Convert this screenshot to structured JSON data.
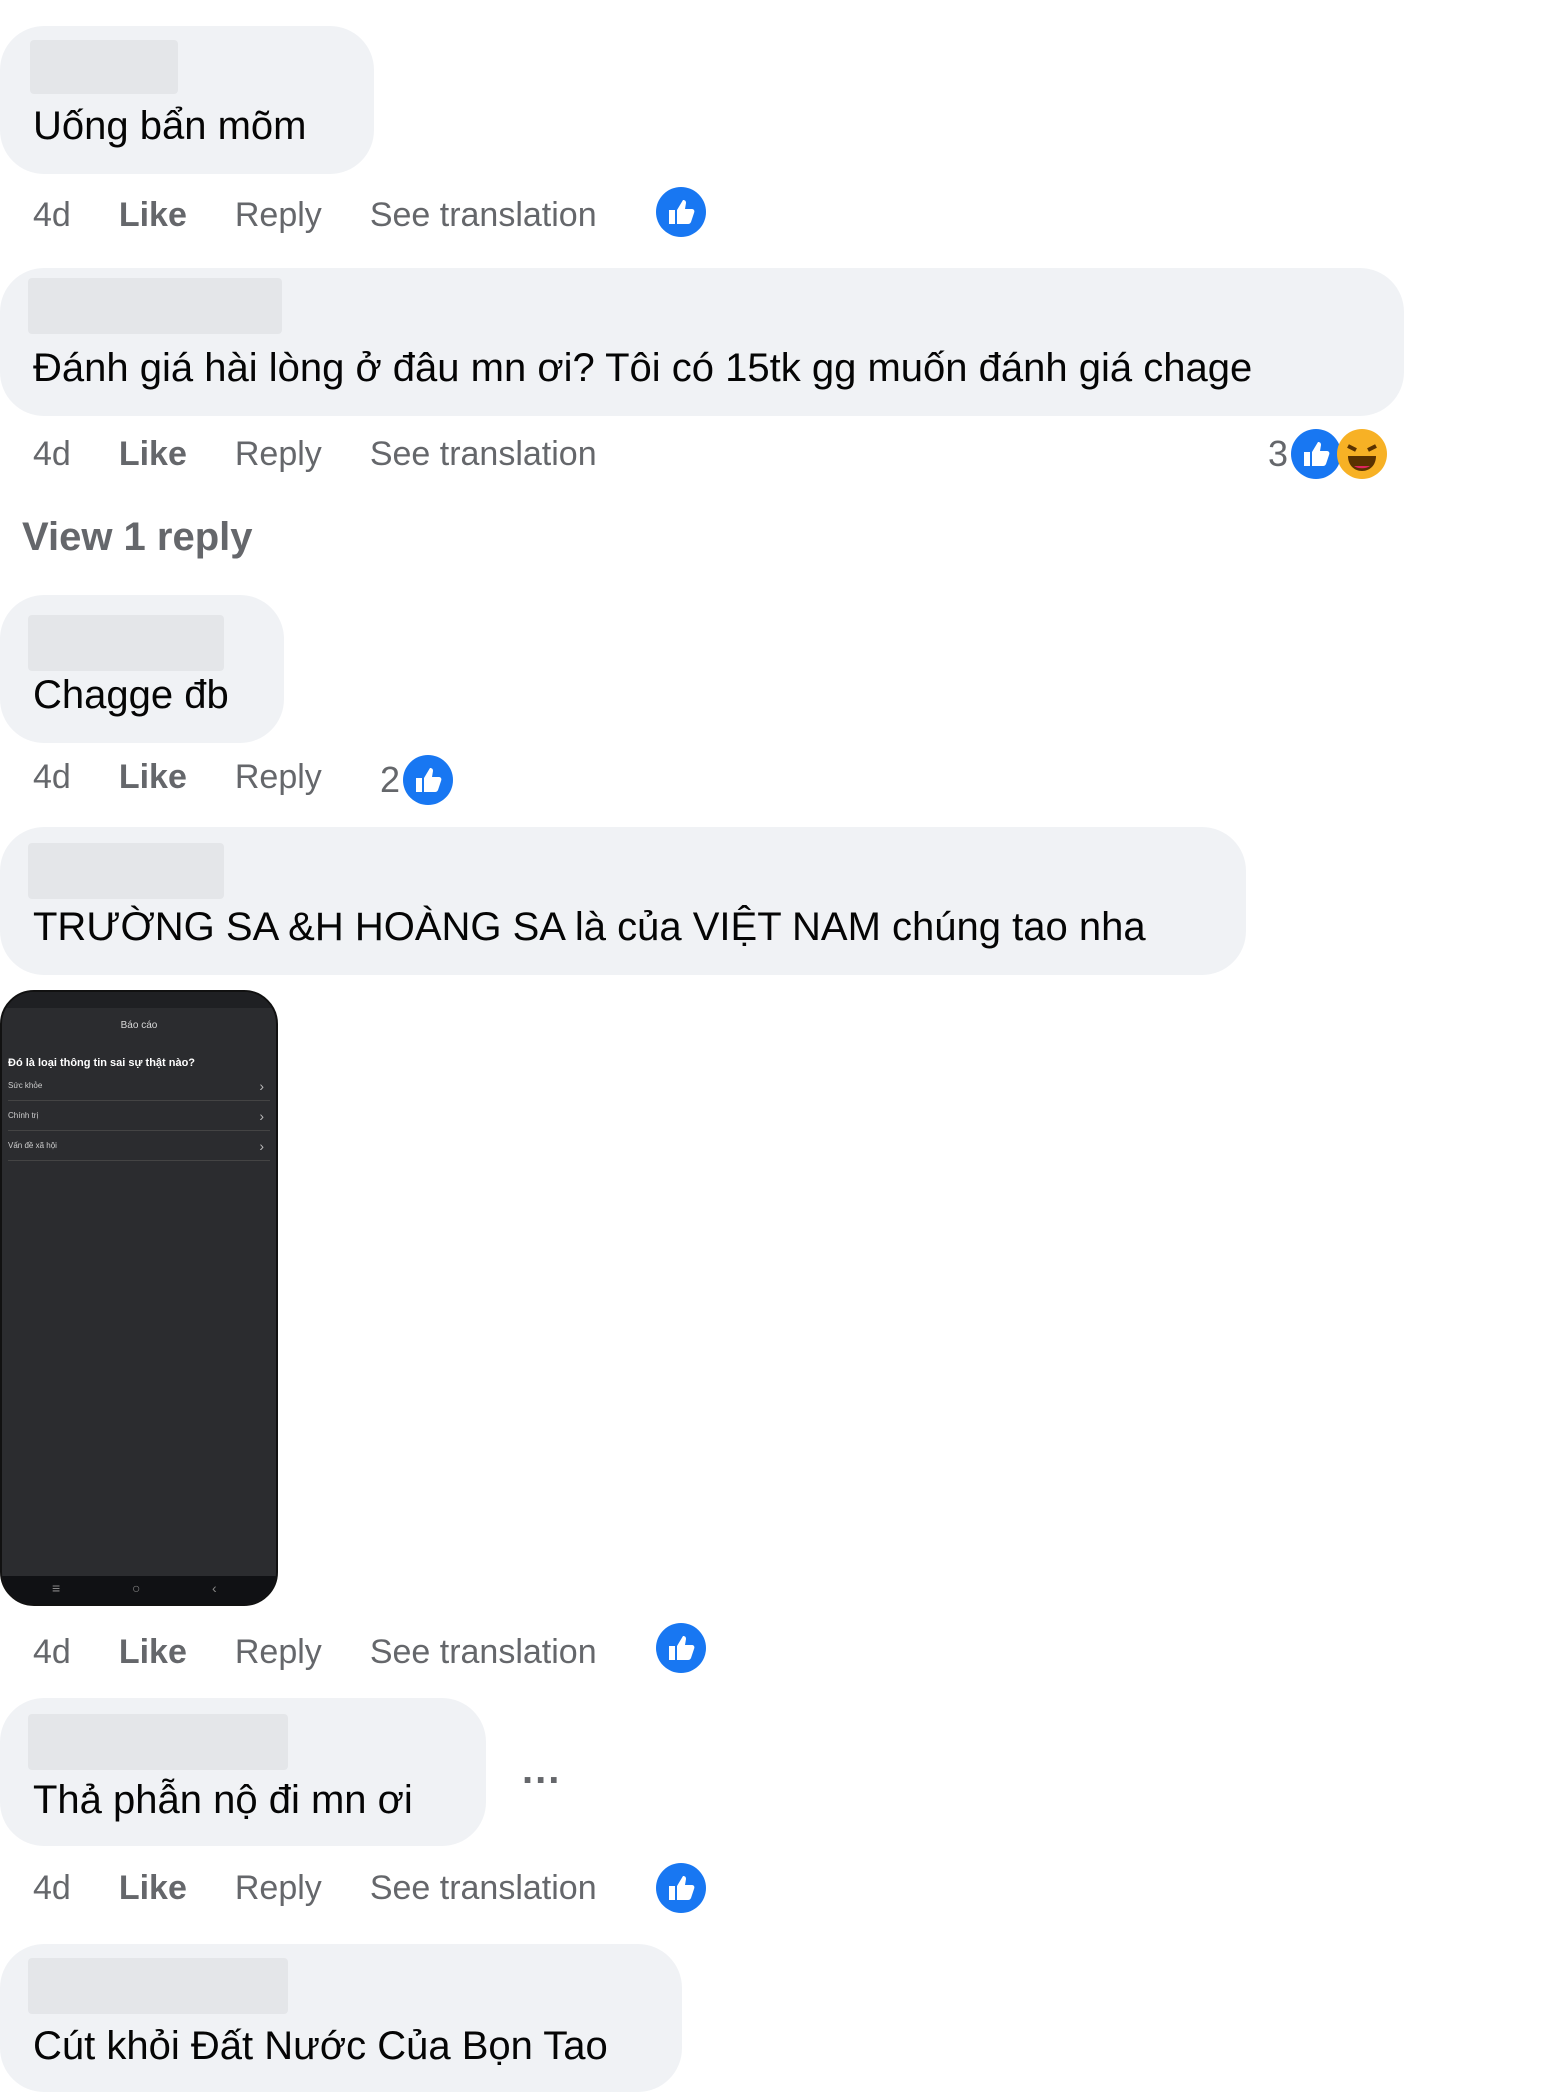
{
  "colors": {
    "like_blue": "#1877f2",
    "bubble_bg": "#f0f2f5",
    "meta_text": "#65676b"
  },
  "labels": {
    "like": "Like",
    "reply": "Reply",
    "see_translation": "See translation",
    "more": "..."
  },
  "comments": [
    {
      "text": "Uống bẩn mõm",
      "time": "4d",
      "reaction_count": ""
    },
    {
      "text": "Đánh giá hài lòng ở đâu mn ơi? Tôi có 15tk gg muốn đánh giá chage",
      "time": "4d",
      "reaction_count": "3",
      "view_replies": "View 1 reply"
    },
    {
      "text": "Chagge đb",
      "time": "4d",
      "reaction_count": "2"
    },
    {
      "text": "TRƯỜNG SA &H HOÀNG SA là của VIỆT NAM chúng tao nha",
      "time": "4d",
      "reaction_count": "",
      "attachment": {
        "title": "Báo cáo",
        "question": "Đó là loại thông tin sai sự thật nào?",
        "options": [
          "Sức khỏe",
          "Chính trị",
          "Vấn đề xã hội"
        ]
      }
    },
    {
      "text": "Thả phẫn nộ đi mn ơi",
      "time": "4d",
      "reaction_count": ""
    },
    {
      "text": "Cút khỏi Đất Nước Của Bọn Tao"
    }
  ],
  "icons": {
    "like": "like-reaction-icon",
    "haha": "haha-reaction-icon"
  }
}
